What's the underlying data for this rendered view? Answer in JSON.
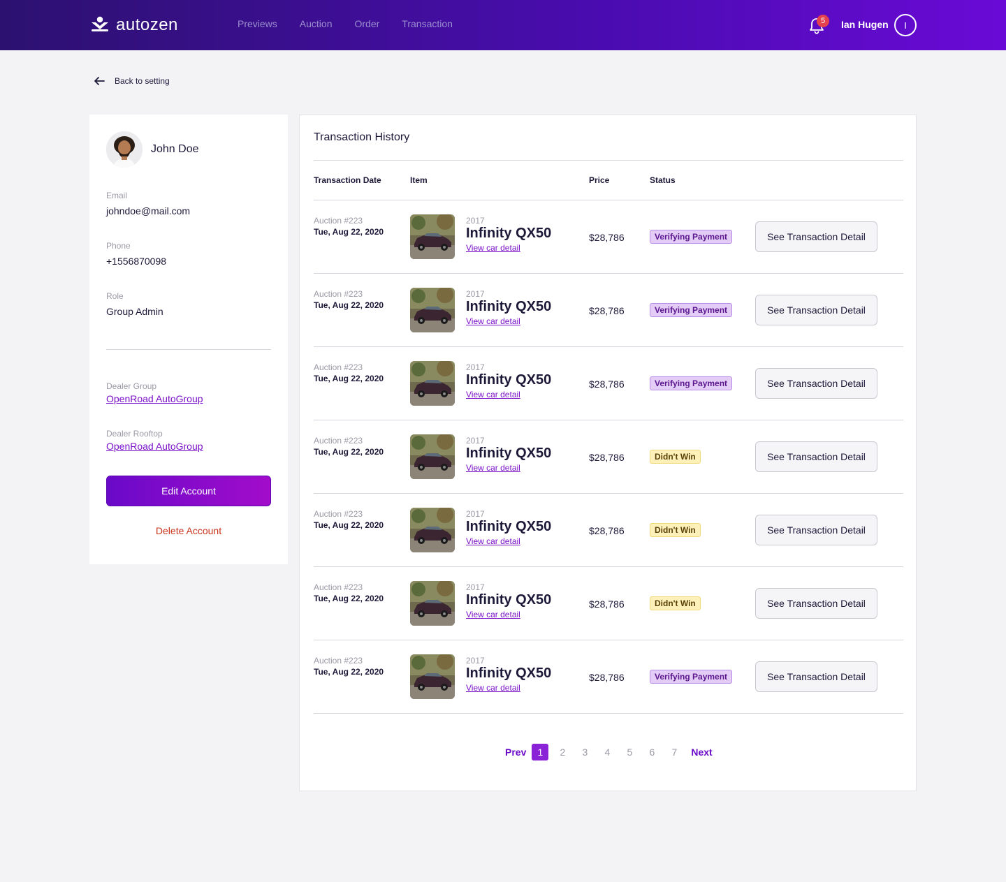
{
  "header": {
    "brand": "autozen",
    "nav": [
      "Previews",
      "Auction",
      "Order",
      "Transaction"
    ],
    "notification_count": "5",
    "user_name": "Ian Hugen",
    "user_initial": "I"
  },
  "back_link": "Back to setting",
  "profile": {
    "name": "John Doe",
    "email_label": "Email",
    "email": "johndoe@mail.com",
    "phone_label": "Phone",
    "phone": "+1556870098",
    "role_label": "Role",
    "role": "Group Admin",
    "dealer_group_label": "Dealer Group",
    "dealer_group": "OpenRoad AutoGroup",
    "dealer_rooftop_label": "Dealer Rooftop",
    "dealer_rooftop": "OpenRoad AutoGroup",
    "edit_label": "Edit Account",
    "delete_label": "Delete Account"
  },
  "transactions": {
    "title": "Transaction History",
    "columns": [
      "Transaction Date",
      "Item",
      "Price",
      "Status"
    ],
    "rows": [
      {
        "auction": "Auction #223",
        "date": "Tue, Aug 22, 2020",
        "year": "2017",
        "model": "Infinity QX50",
        "view": "View car detail",
        "price": "$28,786",
        "status": "Verifying Payment",
        "status_type": "verifying",
        "action": "See Transaction Detail"
      },
      {
        "auction": "Auction #223",
        "date": "Tue, Aug 22, 2020",
        "year": "2017",
        "model": "Infinity QX50",
        "view": "View car detail",
        "price": "$28,786",
        "status": "Verifying Payment",
        "status_type": "verifying",
        "action": "See Transaction Detail"
      },
      {
        "auction": "Auction #223",
        "date": "Tue, Aug 22, 2020",
        "year": "2017",
        "model": "Infinity QX50",
        "view": "View car detail",
        "price": "$28,786",
        "status": "Verifying Payment",
        "status_type": "verifying",
        "action": "See Transaction Detail"
      },
      {
        "auction": "Auction #223",
        "date": "Tue, Aug 22, 2020",
        "year": "2017",
        "model": "Infinity QX50",
        "view": "View car detail",
        "price": "$28,786",
        "status": "Didn't Win",
        "status_type": "lost",
        "action": "See Transaction Detail"
      },
      {
        "auction": "Auction #223",
        "date": "Tue, Aug 22, 2020",
        "year": "2017",
        "model": "Infinity QX50",
        "view": "View car detail",
        "price": "$28,786",
        "status": "Didn't Win",
        "status_type": "lost",
        "action": "See Transaction Detail"
      },
      {
        "auction": "Auction #223",
        "date": "Tue, Aug 22, 2020",
        "year": "2017",
        "model": "Infinity QX50",
        "view": "View car detail",
        "price": "$28,786",
        "status": "Didn't Win",
        "status_type": "lost",
        "action": "See Transaction Detail"
      },
      {
        "auction": "Auction #223",
        "date": "Tue, Aug 22, 2020",
        "year": "2017",
        "model": "Infinity QX50",
        "view": "View car detail",
        "price": "$28,786",
        "status": "Verifying Payment",
        "status_type": "verifying",
        "action": "See Transaction Detail"
      }
    ]
  },
  "pagination": {
    "prev": "Prev",
    "next": "Next",
    "pages": [
      "1",
      "2",
      "3",
      "4",
      "5",
      "6",
      "7"
    ],
    "current": "1"
  },
  "colors": {
    "brand_gradient_start": "#2c1170",
    "brand_gradient_end": "#6a0ad6",
    "accent": "#7a10c8",
    "danger": "#c8341c",
    "badge_verifying": "#e3cdf7",
    "badge_lost": "#fdf0b8"
  },
  "icons": {
    "logo": "autozen-logo-icon",
    "bell": "bell-icon",
    "back": "arrow-left-icon"
  }
}
